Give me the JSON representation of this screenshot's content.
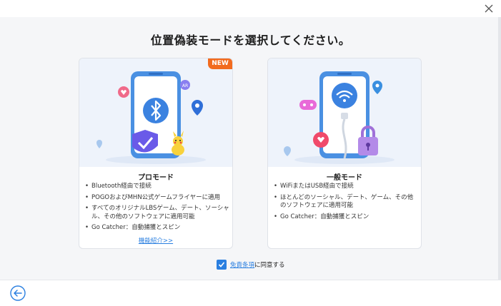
{
  "dialog": {
    "title": "位置偽装モードを選択してください。",
    "close_icon": "close-icon"
  },
  "cards": {
    "pro": {
      "badge": "NEW",
      "title": "プロモード",
      "features": [
        "Bluetooth経由で接続",
        "POGOおよびMHN公式ゲームフライヤーに適用",
        "すべてのオリジナルLBSゲーム、デート、ソーシャル、その他のソフトウェアに適用可能",
        "Go Catcher：自動捕獲とスピン"
      ],
      "link": "機能紹介>>",
      "icon": "bluetooth-icon"
    },
    "normal": {
      "title": "一般モード",
      "features": [
        "WiFiまたはUSB経由で接続",
        "ほとんどのソーシャル、デート、ゲーム、その他のソフトウェアに適用可能",
        "Go Catcher：自動捕獲とスピン"
      ],
      "icon": "wifi-icon"
    }
  },
  "agreement": {
    "checked": true,
    "link_text": "免責条項",
    "suffix": "に同意する"
  },
  "footer": {
    "back_icon": "back-arrow-icon"
  },
  "colors": {
    "accent": "#2a7fe0",
    "badge": "#f26b1f",
    "phone": "#4a90e2",
    "illustration_bg": "#eef3fb"
  }
}
